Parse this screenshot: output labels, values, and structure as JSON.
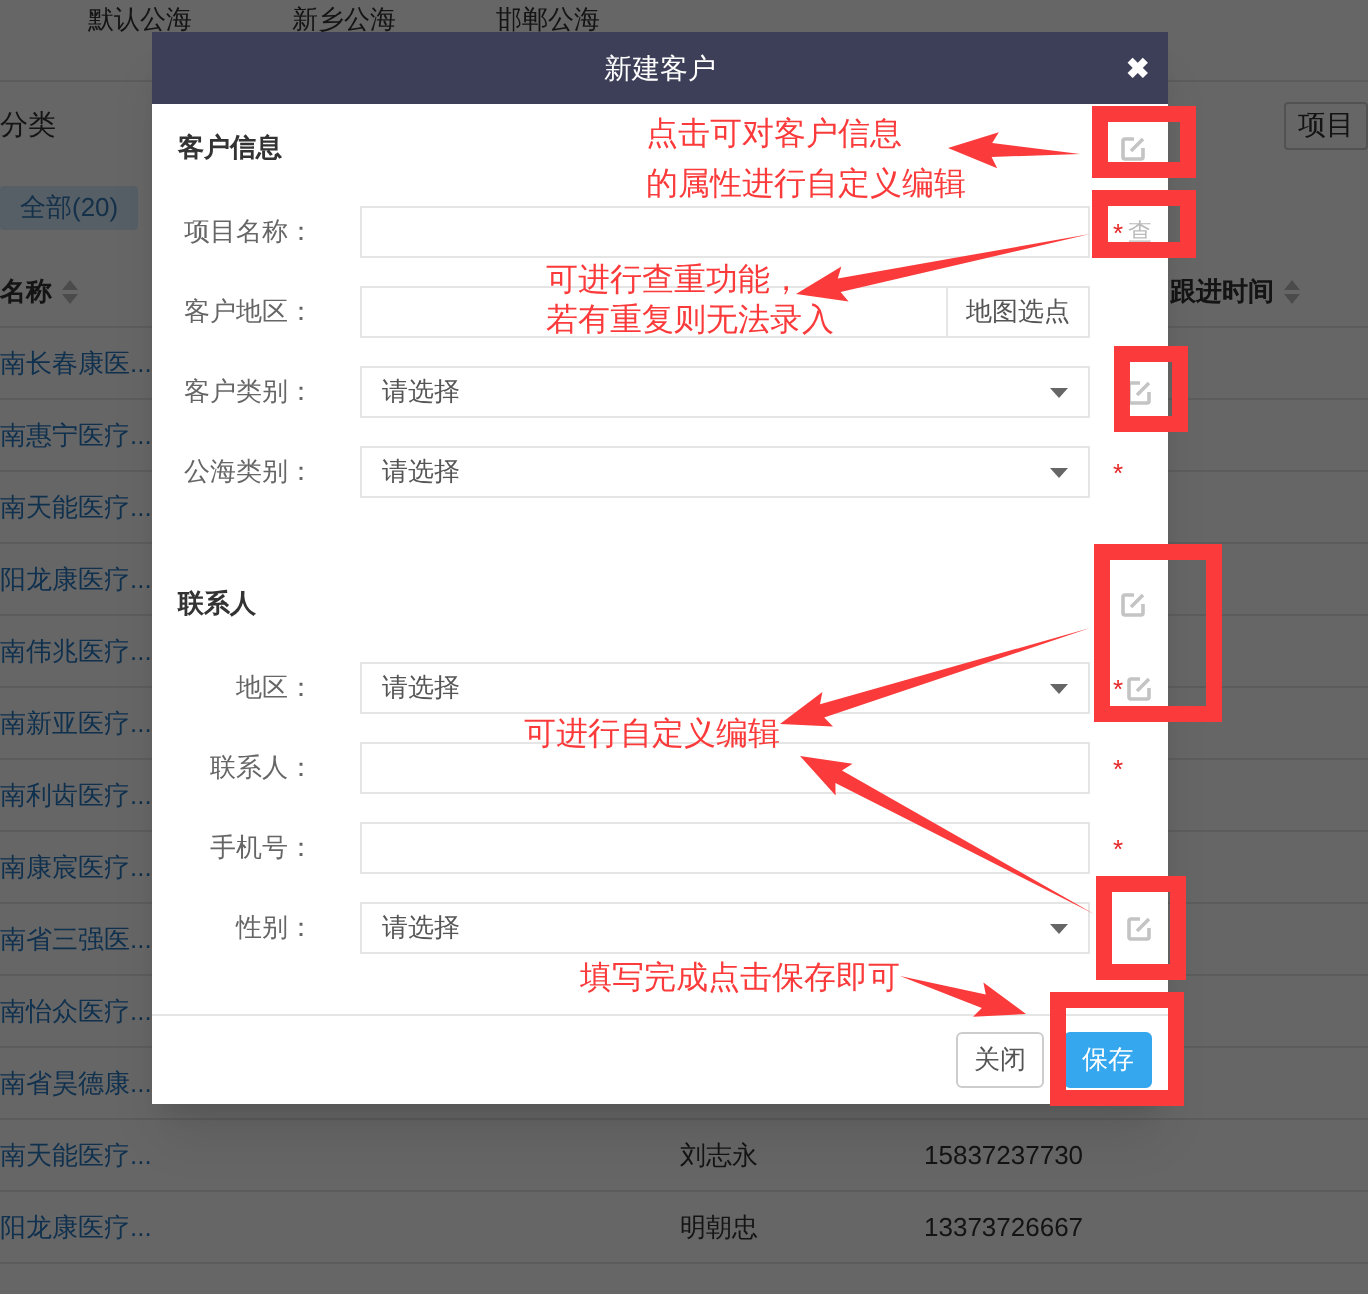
{
  "page": {
    "tabs": [
      {
        "label": "默认公海"
      },
      {
        "label": "新乡公海"
      },
      {
        "label": "邯郸公海"
      }
    ],
    "filter_label": "分类",
    "filter_chip": {
      "label": "全部(20)",
      "selected": true
    },
    "project_button": "项目",
    "table": {
      "columns": [
        "名称",
        "跟进时间"
      ],
      "rows": [
        {
          "name": "南长春康医..."
        },
        {
          "name": "南惠宁医疗..."
        },
        {
          "name": "南天能医疗..."
        },
        {
          "name": "阳龙康医疗..."
        },
        {
          "name": "南伟兆医疗..."
        },
        {
          "name": "南新亚医疗..."
        },
        {
          "name": "南利齿医疗..."
        },
        {
          "name": "南康宸医疗..."
        },
        {
          "name": "南省三强医..."
        },
        {
          "name": "南怡众医疗..."
        },
        {
          "name": "南省昊德康..."
        },
        {
          "name": "南天能医疗...",
          "contact": "刘志永",
          "phone": "15837237730"
        },
        {
          "name": "阳龙康医疗...",
          "contact": "明朝忠",
          "phone": "13373726667"
        }
      ]
    }
  },
  "dialog": {
    "title": "新建客户",
    "close": "✖",
    "sections": [
      {
        "title": "客户信息",
        "editable": true,
        "fields": [
          {
            "label": "项目名称：",
            "kind": "text",
            "required_mark": "*",
            "action": "查"
          },
          {
            "label": "客户地区：",
            "kind": "map",
            "button": "地图选点"
          },
          {
            "label": "客户类别：",
            "kind": "select",
            "value": "请选择",
            "editable": true
          },
          {
            "label": "公海类别：",
            "kind": "select",
            "value": "请选择",
            "required_mark": "*"
          }
        ]
      },
      {
        "title": "联系人",
        "editable": true,
        "fields": [
          {
            "label": "地区：",
            "kind": "select",
            "value": "请选择",
            "required_mark": "*",
            "editable": true
          },
          {
            "label": "联系人：",
            "kind": "text",
            "required_mark": "*"
          },
          {
            "label": "手机号：",
            "kind": "text",
            "required_mark": "*"
          },
          {
            "label": "性别：",
            "kind": "select",
            "value": "请选择",
            "editable": true
          }
        ]
      }
    ],
    "buttons": [
      {
        "label": "关闭",
        "kind": "secondary"
      },
      {
        "label": "保存",
        "kind": "primary"
      }
    ]
  },
  "annotations": [
    {
      "lines": [
        "点击可对客户信息",
        "的属性进行自定义编辑"
      ]
    },
    {
      "lines": [
        "可进行查重功能，",
        "若有重复则无法录入"
      ]
    },
    {
      "lines": [
        "可进行自定义编辑"
      ]
    },
    {
      "lines": [
        "填写完成点击保存即可"
      ]
    }
  ]
}
